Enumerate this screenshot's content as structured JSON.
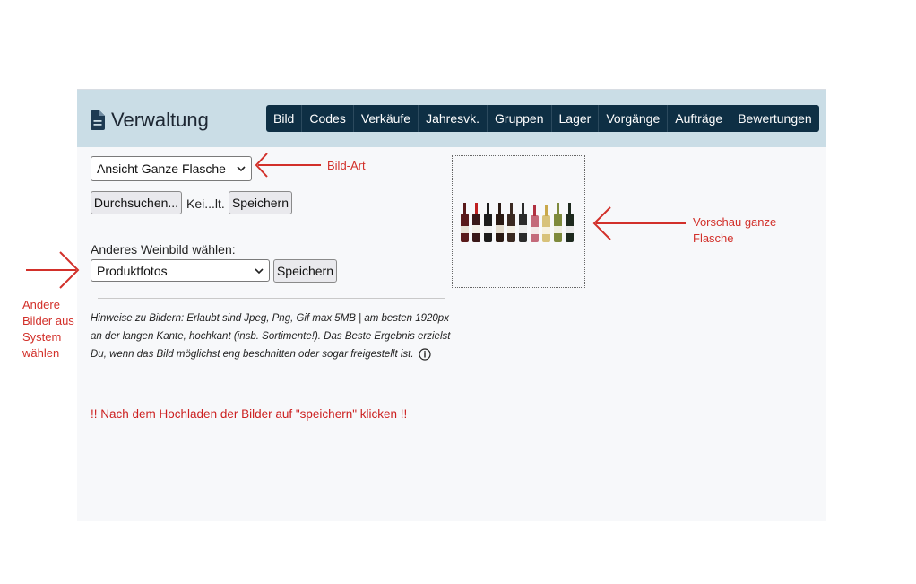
{
  "header": {
    "title": "Verwaltung",
    "tabs": [
      "Bild",
      "Codes",
      "Verkäufe",
      "Jahresvk.",
      "Gruppen",
      "Lager",
      "Vorgänge",
      "Aufträge",
      "Bewertungen"
    ]
  },
  "form": {
    "image_type_select": "Ansicht Ganze Flasche",
    "browse_button": "Durchsuchen...",
    "file_status": "Kei...lt.",
    "save_button_1": "Speichern",
    "other_image_label": "Anderes Weinbild wählen:",
    "other_image_select": "Produktfotos",
    "save_button_2": "Speichern",
    "hint_text": "Hinweise zu Bildern: Erlaubt sind Jpeg, Png, Gif max 5MB | am besten 1920px an der langen Kante, hochkant (insb. Sortimente!). Das Beste Ergebnis erzielst Du, wenn das Bild möglichst eng beschnitten oder sogar freigestellt ist.",
    "warning_text": "!! Nach dem Hochladen der Bilder auf \"speichern\" klicken !!"
  },
  "annotations": {
    "bild_art": "Bild-Art",
    "vorschau_line1": "Vorschau ganze",
    "vorschau_line2": "Flasche",
    "andere_line1": "Andere",
    "andere_line2": "Bilder aus",
    "andere_line3": "System",
    "andere_line4": "wählen"
  },
  "colors": {
    "header_bg": "#cadde6",
    "tab_bg": "#0e2f44",
    "annotation_red": "#d2302a",
    "warning_red": "#cc2020"
  }
}
